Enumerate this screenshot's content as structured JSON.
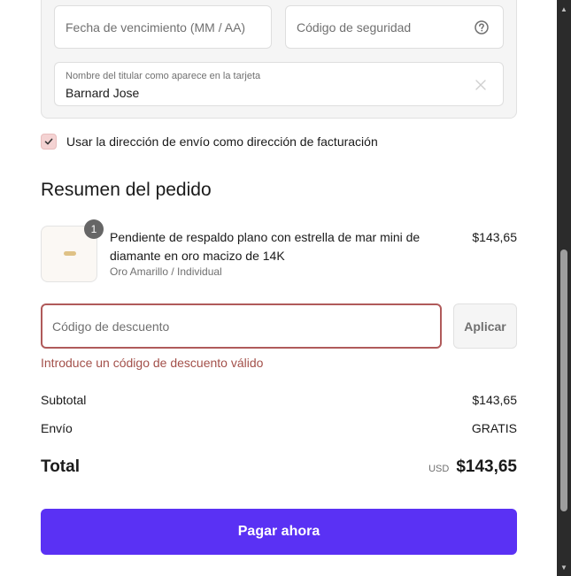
{
  "card": {
    "expiry_placeholder": "Fecha de vencimiento (MM / AA)",
    "cvv_placeholder": "Código de seguridad",
    "name_label": "Nombre del titular como aparece en la tarjeta",
    "name_value": "Barnard Jose"
  },
  "billing": {
    "checked": true,
    "label": "Usar la dirección de envío como dirección de facturación"
  },
  "summary": {
    "title": "Resumen del pedido",
    "product": {
      "quantity": "1",
      "name": "Pendiente de respaldo plano con estrella de mar mini de diamante en oro macizo de 14K",
      "variant": "Oro Amarillo / Individual",
      "price": "$143,65"
    },
    "discount": {
      "placeholder": "Código de descuento",
      "apply_label": "Aplicar",
      "error": "Introduce un código de descuento válido"
    },
    "subtotal_label": "Subtotal",
    "subtotal_value": "$143,65",
    "shipping_label": "Envío",
    "shipping_value": "GRATIS",
    "total_label": "Total",
    "total_currency": "USD",
    "total_value": "$143,65"
  },
  "pay_button": "Pagar ahora",
  "colors": {
    "pay_button": "#5a31f4",
    "error": "#a3504a",
    "checkbox": "#f4d3d3"
  },
  "icons": {
    "cvv_help": "question-circle-icon",
    "name_clear": "close-icon",
    "checkbox": "check-icon"
  }
}
